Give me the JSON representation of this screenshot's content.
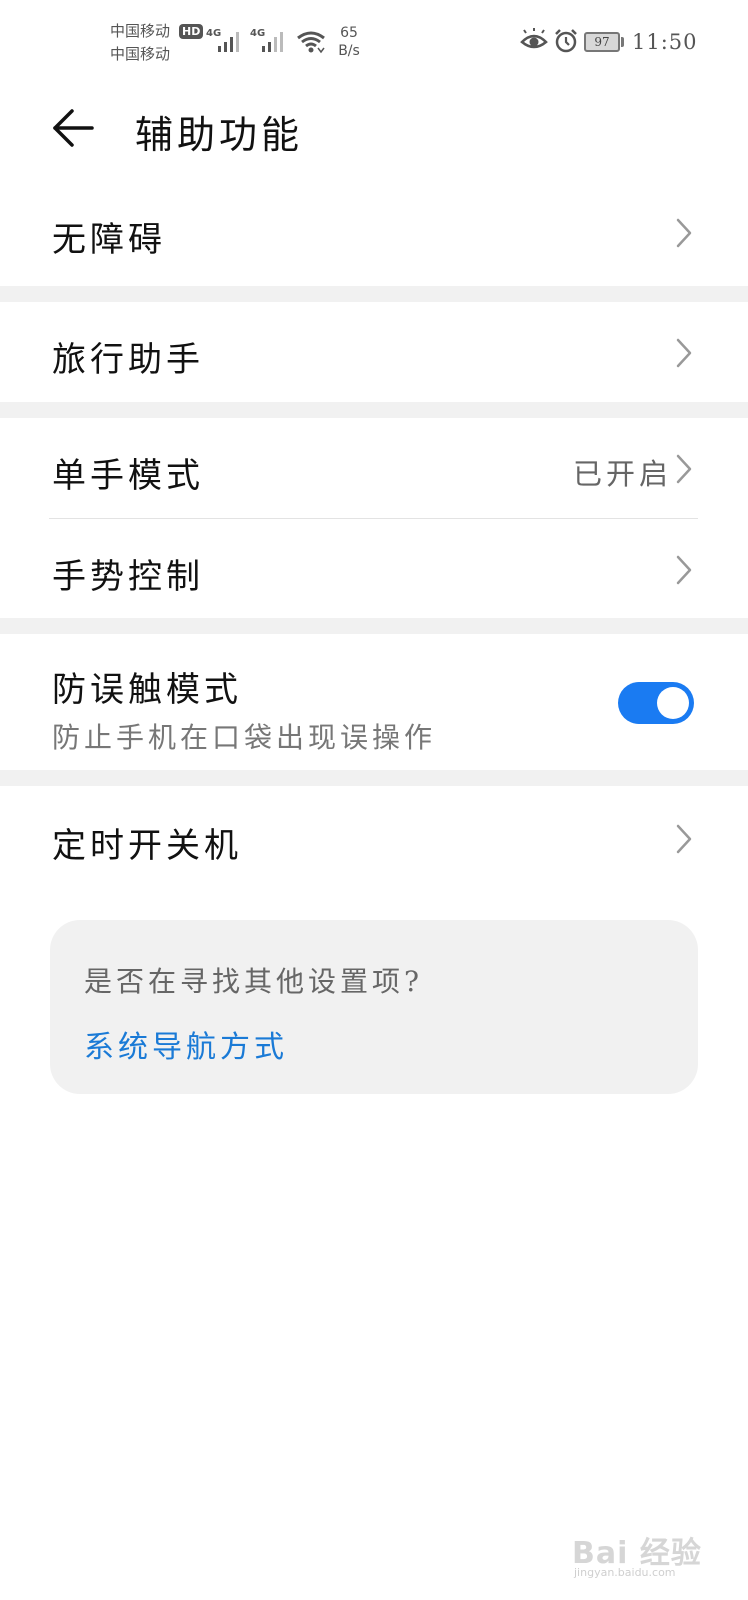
{
  "status_bar": {
    "carrier_1": "中国移动",
    "carrier_2": "中国移动",
    "hd_badge": "HD",
    "network_1": "4G",
    "network_2": "4G",
    "net_speed_value": "65",
    "net_speed_unit": "B/s",
    "battery_level": "97",
    "time": "11:50",
    "icons": [
      "signal-icon",
      "wifi-icon",
      "eye-comfort-icon",
      "alarm-icon",
      "battery-icon"
    ]
  },
  "header": {
    "title": "辅助功能",
    "back_icon": "arrow-left-icon"
  },
  "items": {
    "accessibility": {
      "label": "无障碍"
    },
    "travel_assistant": {
      "label": "旅行助手"
    },
    "one_hand_mode": {
      "label": "单手模式",
      "value": "已开启"
    },
    "gesture_control": {
      "label": "手势控制"
    },
    "mistouch_prevention": {
      "label": "防误触模式",
      "description": "防止手机在口袋出现误操作",
      "enabled": true
    },
    "scheduled_power": {
      "label": "定时开关机"
    }
  },
  "suggestion": {
    "prompt": "是否在寻找其他设置项?",
    "link": "系统导航方式"
  },
  "watermark": {
    "text": "Bai 经验",
    "url": "jingyan.baidu.com"
  },
  "colors": {
    "accent": "#1a7bf2",
    "link": "#1a7ad6",
    "section_gap": "#f1f1f1",
    "card_bg": "#f1f1f1"
  }
}
